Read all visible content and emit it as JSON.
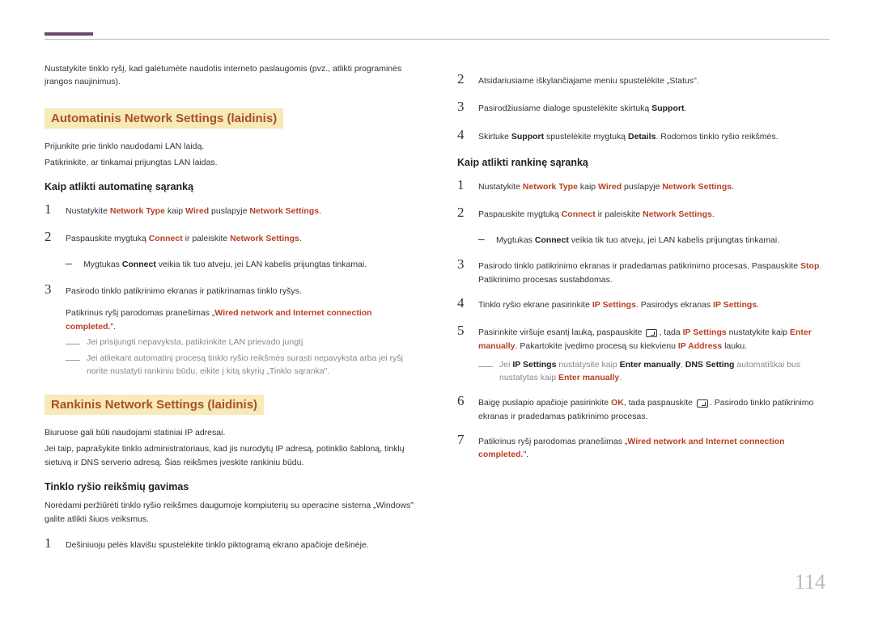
{
  "pageNumber": "114",
  "left": {
    "intro": "Nustatykite tinklo ryšį, kad galėtumėte naudotis interneto paslaugomis (pvz., atlikti programinės įrangos naujinimus).",
    "section1": {
      "title": "Automatinis Network Settings (laidinis)",
      "l1": "Prijunkite prie tinklo naudodami LAN laidą.",
      "l2": "Patikrinkite, ar tinkamai prijungtas LAN laidas.",
      "sub": "Kaip atlikti automatinę sąranką",
      "s1a": "Nustatykite ",
      "s1b": " kaip ",
      "s1c": " puslapyje ",
      "s1_nt": "Network Type",
      "s1_w": "Wired",
      "s1_ns": "Network Settings",
      "s1d": ".",
      "s2a": "Paspauskite mygtuką ",
      "s2_c": "Connect",
      "s2b": " ir paleiskite ",
      "s2_ns": "Network Settings",
      "s2c": ".",
      "sub2a": "Mygtukas ",
      "sub2_c": "Connect",
      "sub2b": " veikia tik tuo atveju, jei LAN kabelis prijungtas tinkamai.",
      "s3": "Pasirodo tinklo patikrinimo ekranas ir patikrinamas tinklo ryšys.",
      "s3note_a": "Patikrinus ryšį parodomas pranešimas „",
      "s3note_red": "Wired network and Internet connection completed.",
      "s3note_b": "\".",
      "note1": "Jei prisijungti nepavyksta, patikrinkite LAN prievado jungtį.",
      "note2": "Jei atliekant automatinį procesą tinklo ryšio reikšmės surasti nepavyksta arba jei ryšį norite nustatyti rankiniu būdu, eikite į kitą skyrių „Tinklo sąranka\"."
    },
    "section2": {
      "title": "Rankinis Network Settings (laidinis)",
      "l1": "Biuruose gali būti naudojami statiniai IP adresai.",
      "l2": "Jei taip, paprašykite tinklo administratoriaus, kad jis nurodytų IP adresą, potinklio šabloną, tinklų sietuvą ir DNS serverio adresą. Šias reikšmes įveskite rankiniu būdu.",
      "sub": "Tinklo ryšio reikšmių gavimas",
      "l3": "Norėdami peržiūrėti tinklo ryšio reikšmes daugumoje kompiuterių su operacine sistema „Windows\" galite atlikti šiuos veiksmus.",
      "s1": "Dešiniuoju pelės klavišu spustelėkite tinklo piktogramą ekrano apačioje dešinėje."
    }
  },
  "right": {
    "s2a": "Atsidariusiame iškylančiajame meniu spustelėkite „",
    "s2_st": "Status",
    "s2b": "\".",
    "s3a": "Pasirodžiusiame dialoge spustelėkite skirtuką ",
    "s3_sup": "Support",
    "s3b": ".",
    "s4a": "Skirtuke ",
    "s4_sup": "Support",
    "s4b": " spustelėkite mygtuką ",
    "s4_det": "Details",
    "s4c": ". Rodomos tinklo ryšio reikšmės.",
    "sub": "Kaip atlikti rankinę sąranką",
    "m1a": "Nustatykite ",
    "m1_nt": "Network Type",
    "m1b": " kaip ",
    "m1_w": "Wired",
    "m1c": " puslapyje ",
    "m1_ns": "Network Settings",
    "m1d": ".",
    "m2a": "Paspauskite mygtuką ",
    "m2_c": "Connect",
    "m2b": " ir paleiskite ",
    "m2_ns": "Network Settings",
    "m2c": ".",
    "msub2a": "Mygtukas ",
    "msub2_c": "Connect",
    "msub2b": " veikia tik tuo atveju, jei LAN kabelis prijungtas tinkamai.",
    "m3a": "Pasirodo tinklo patikrinimo ekranas ir pradedamas patikrinimo procesas. Paspauskite ",
    "m3_stop": "Stop",
    "m3b": ". Patikrinimo procesas sustabdomas.",
    "m4a": "Tinklo ryšio ekrane pasirinkite ",
    "m4_ip1": "IP Settings",
    "m4b": ". Pasirodys ekranas ",
    "m4_ip2": "IP Settings",
    "m4c": ".",
    "m5a": "Pasirinkite viršuje esantį lauką, paspauskite ",
    "m5b": ", tada ",
    "m5_ip": "IP Settings",
    "m5c": " nustatykite kaip ",
    "m5_em": "Enter manually",
    "m5d": ". Pakartokite įvedimo procesą su kiekvienu ",
    "m5_ipa": "IP Address",
    "m5e": " lauku.",
    "mnote_a": "Jei ",
    "mnote_ip": "IP Settings",
    "mnote_b": " nustatysite kaip ",
    "mnote_em": "Enter manually",
    "mnote_c": ", ",
    "mnote_dns": "DNS Setting",
    "mnote_d": " automatiškai bus nustatytas kaip ",
    "mnote_em2": "Enter manually",
    "mnote_e": ".",
    "m6a": "Baigę puslapio apačioje pasirinkite ",
    "m6_ok": "OK",
    "m6b": ", tada paspauskite ",
    "m6c": ". Pasirodo tinklo patikrinimo ekranas ir pradedamas patikrinimo procesas.",
    "m7a": "Patikrinus ryšį parodomas pranešimas „",
    "m7_red": "Wired network and Internet connection completed.",
    "m7b": "\"."
  }
}
